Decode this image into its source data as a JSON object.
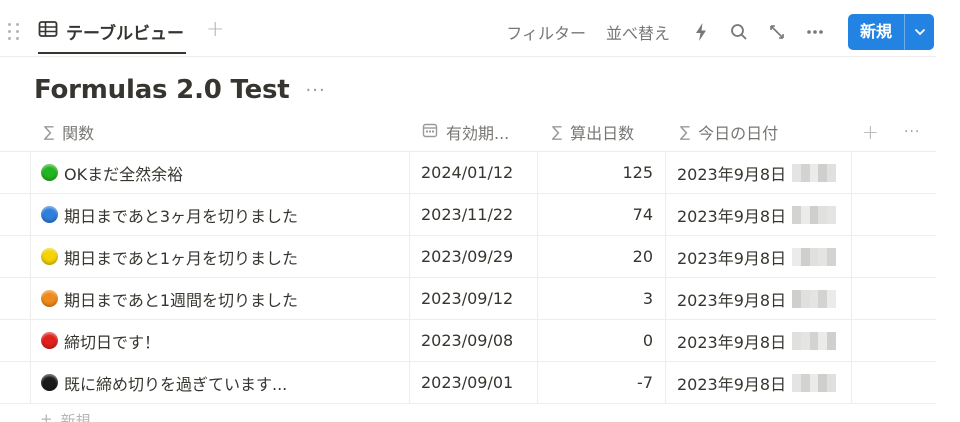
{
  "view": {
    "tab_label": "テーブルビュー",
    "add_view_icon": "plus-icon"
  },
  "toolbar": {
    "filter": "フィルター",
    "sort": "並べ替え",
    "new_label": "新規"
  },
  "page": {
    "title": "Formulas 2.0 Test",
    "title_more": "···"
  },
  "table": {
    "headers": [
      {
        "label": "関数",
        "icon": "sigma-icon"
      },
      {
        "label": "有効期...",
        "icon": "calendar-icon"
      },
      {
        "label": "算出日数",
        "icon": "sigma-icon"
      },
      {
        "label": "今日の日付",
        "icon": "sigma-icon"
      }
    ],
    "header_more": "···",
    "rows": [
      {
        "name": "OKまだ全然余裕",
        "status_color": "#22b521",
        "date": "2024/01/12",
        "days": "125",
        "today": "2023年9月8日"
      },
      {
        "name": "期日まであと3ヶ月を切りました",
        "status_color": "#2f7fdd",
        "date": "2023/11/22",
        "days": "74",
        "today": "2023年9月8日"
      },
      {
        "name": "期日まであと1ヶ月を切りました",
        "status_color": "#f5d200",
        "date": "2023/09/29",
        "days": "20",
        "today": "2023年9月8日"
      },
      {
        "name": "期日まであと1週間を切りました",
        "status_color": "#f08a1c",
        "date": "2023/09/12",
        "days": "3",
        "today": "2023年9月8日"
      },
      {
        "name": "締切日です！",
        "status_color": "#e0201c",
        "date": "2023/09/08",
        "days": "0",
        "today": "2023年9月8日"
      },
      {
        "name": "既に締め切りを過ぎています...",
        "status_color": "#1b1b1b",
        "date": "2023/09/01",
        "days": "-7",
        "today": "2023年9月8日"
      }
    ]
  },
  "footer": {
    "new_row": "新規"
  },
  "colors": {
    "accent": "#2383e2",
    "text": "#37352f",
    "muted": "#787774"
  }
}
